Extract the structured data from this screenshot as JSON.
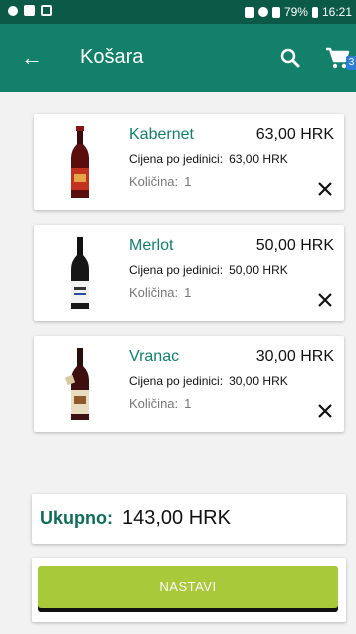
{
  "status_bar": {
    "battery": "79%",
    "time": "16:21"
  },
  "app_bar": {
    "title": "Košara",
    "cart_count": "3",
    "back_icon": "arrow-back-icon",
    "search_icon": "search-icon",
    "cart_icon": "shopping-cart-icon"
  },
  "cart": {
    "items": [
      {
        "name": "Kabernet",
        "price": "63,00 HRK",
        "unit_label": "Cijena po jedinici:",
        "unit_price": "63,00 HRK",
        "qty_label": "Količina:",
        "qty": "1"
      },
      {
        "name": "Merlot",
        "price": "50,00 HRK",
        "unit_label": "Cijena po jedinici:",
        "unit_price": "50,00 HRK",
        "qty_label": "Količina:",
        "qty": "1"
      },
      {
        "name": "Vranac",
        "price": "30,00 HRK",
        "unit_label": "Cijena po jedinici:",
        "unit_price": "30,00 HRK",
        "qty_label": "Količina:",
        "qty": "1"
      }
    ]
  },
  "total": {
    "label": "Ukupno:",
    "value": "143,00 HRK"
  },
  "actions": {
    "continue_label": "NASTAVI"
  },
  "colors": {
    "status_bar": "#0b5a47",
    "app_bar": "#13806a",
    "accent_text": "#13806a",
    "button": "#a8c93a"
  }
}
